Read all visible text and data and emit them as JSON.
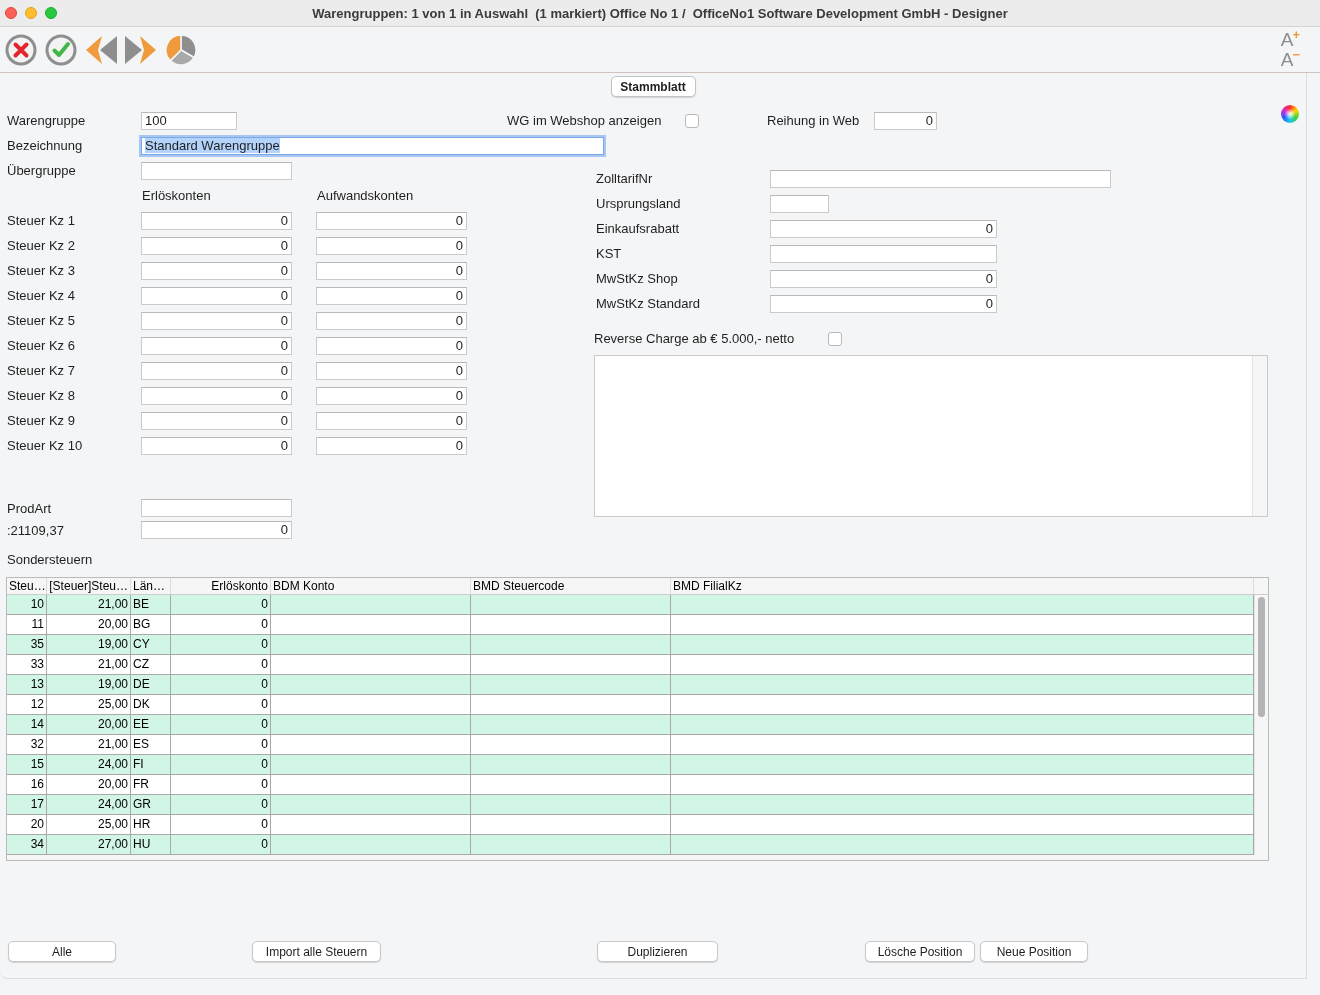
{
  "window": {
    "title": "Warengruppen: 1 von 1 in Auswahl  (1 markiert) Office No 1 /  OfficeNo1 Software Development GmbH - Designer"
  },
  "toolbar": {
    "font_size": [
      {
        "glyph": "A",
        "sign": "+"
      },
      {
        "glyph": "A",
        "sign": "−"
      }
    ]
  },
  "tabs": [
    {
      "label": "Stammblatt",
      "selected": true
    }
  ],
  "form": {
    "warengruppe": {
      "label": "Warengruppe",
      "value": "100"
    },
    "webshop": {
      "label": "WG im Webshop anzeigen",
      "checked": false
    },
    "reihung": {
      "label": "Reihung in Web",
      "value": "0",
      "kind": "number"
    },
    "bezeichnung": {
      "label": "Bezeichnung",
      "value": "Standard Warengruppe",
      "focused": true
    },
    "uebergruppe": {
      "label": "Übergruppe"
    },
    "account_columns": [
      "Erlöskonten",
      "Aufwandskonten"
    ],
    "steuer_kz": [
      {
        "label": "Steuer Kz 1",
        "values": [
          "0",
          "0"
        ]
      },
      {
        "label": "Steuer Kz 2",
        "values": [
          "0",
          "0"
        ]
      },
      {
        "label": "Steuer Kz 3",
        "values": [
          "0",
          "0"
        ]
      },
      {
        "label": "Steuer Kz 4",
        "values": [
          "0",
          "0"
        ]
      },
      {
        "label": "Steuer Kz 5",
        "values": [
          "0",
          "0"
        ]
      },
      {
        "label": "Steuer Kz 6",
        "values": [
          "0",
          "0"
        ]
      },
      {
        "label": "Steuer Kz 7",
        "values": [
          "0",
          "0"
        ]
      },
      {
        "label": "Steuer Kz 8",
        "values": [
          "0",
          "0"
        ]
      },
      {
        "label": "Steuer Kz 9",
        "values": [
          "0",
          "0"
        ]
      },
      {
        "label": "Steuer Kz 10",
        "values": [
          "0",
          "0"
        ]
      }
    ],
    "prodart": {
      "label": "ProdArt"
    },
    "extra": {
      "label": ":21109,37",
      "value": "0",
      "kind": "number"
    }
  },
  "details": [
    {
      "label": "ZolltarifNr"
    },
    {
      "label": "Ursprungsland"
    },
    {
      "label": "Einkaufsrabatt",
      "value": "0",
      "kind": "number"
    },
    {
      "label": "KST"
    },
    {
      "label": "MwStKz Shop",
      "value": "0",
      "kind": "number"
    },
    {
      "label": "MwStKz Standard",
      "value": "0",
      "kind": "number"
    }
  ],
  "reverse_charge": {
    "label": "Reverse Charge ab € 5.000,- netto",
    "checked": false
  },
  "sondersteuern": {
    "title": "Sondersteuern",
    "columns": [
      {
        "label": "Steu…",
        "kind": "number"
      },
      {
        "label": "[Steuer]Steu…",
        "kind": "number"
      },
      {
        "label": "Län…",
        "kind": "text"
      },
      {
        "label": "Erlöskonto",
        "kind": "number"
      },
      {
        "label": "BDM Konto",
        "kind": "text"
      },
      {
        "label": "BMD Steuercode",
        "kind": "text"
      },
      {
        "label": "BMD FilialKz",
        "kind": "text"
      }
    ],
    "rows": [
      {
        "cells": [
          "10",
          "21,00",
          "BE",
          "0"
        ]
      },
      {
        "cells": [
          "11",
          "20,00",
          "BG",
          "0"
        ]
      },
      {
        "cells": [
          "35",
          "19,00",
          "CY",
          "0"
        ]
      },
      {
        "cells": [
          "33",
          "21,00",
          "CZ",
          "0"
        ]
      },
      {
        "cells": [
          "13",
          "19,00",
          "DE",
          "0"
        ]
      },
      {
        "cells": [
          "12",
          "25,00",
          "DK",
          "0"
        ]
      },
      {
        "cells": [
          "14",
          "20,00",
          "EE",
          "0"
        ]
      },
      {
        "cells": [
          "32",
          "21,00",
          "ES",
          "0"
        ]
      },
      {
        "cells": [
          "15",
          "24,00",
          "FI",
          "0"
        ]
      },
      {
        "cells": [
          "16",
          "20,00",
          "FR",
          "0"
        ]
      },
      {
        "cells": [
          "17",
          "24,00",
          "GR",
          "0"
        ]
      },
      {
        "cells": [
          "20",
          "25,00",
          "HR",
          "0"
        ]
      },
      {
        "cells": [
          "34",
          "27,00",
          "HU",
          "0"
        ]
      }
    ]
  },
  "buttons": [
    "Alle",
    "Import alle Steuern",
    "Duplizieren",
    "Lösche Position",
    "Neue Position"
  ]
}
